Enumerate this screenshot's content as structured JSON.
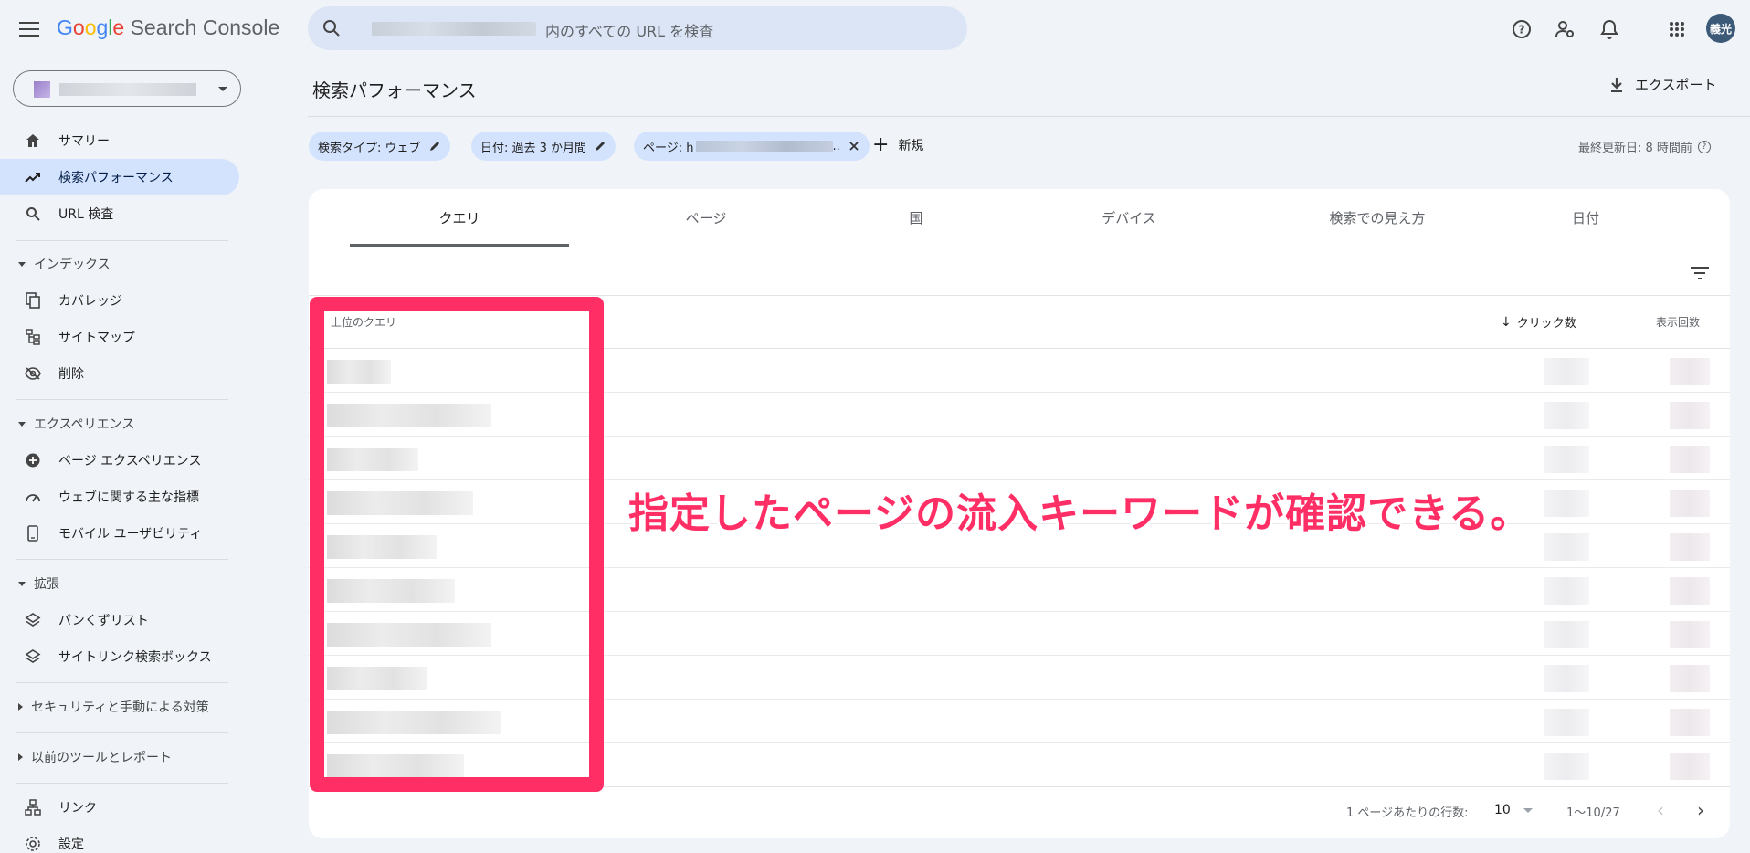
{
  "app": {
    "logo_google": "Google",
    "logo_rest": "Search Console"
  },
  "search": {
    "placeholder": "内のすべての URL を検査"
  },
  "avatar": {
    "text": "義光"
  },
  "sidebar": {
    "items": [
      {
        "label": "サマリー",
        "icon": "home-icon"
      },
      {
        "label": "検索パフォーマンス",
        "icon": "trending-up-icon"
      },
      {
        "label": "URL 検査",
        "icon": "search-icon"
      }
    ],
    "sections": [
      {
        "label": "インデックス",
        "items": [
          {
            "label": "カバレッジ",
            "icon": "file-copy-icon"
          },
          {
            "label": "サイトマップ",
            "icon": "sitemap-icon"
          },
          {
            "label": "削除",
            "icon": "visibility-off-icon"
          }
        ]
      },
      {
        "label": "エクスペリエンス",
        "items": [
          {
            "label": "ページ エクスペリエンス",
            "icon": "add-circle-icon"
          },
          {
            "label": "ウェブに関する主な指標",
            "icon": "speed-icon"
          },
          {
            "label": "モバイル ユーザビリティ",
            "icon": "smartphone-icon"
          }
        ]
      },
      {
        "label": "拡張",
        "items": [
          {
            "label": "パンくずリスト",
            "icon": "layers-icon"
          },
          {
            "label": "サイトリンク検索ボックス",
            "icon": "layers-icon"
          }
        ]
      }
    ],
    "collapsed": [
      "セキュリティと手動による対策",
      "以前のツールとレポート"
    ],
    "bottom": [
      {
        "label": "リンク",
        "icon": "links-icon"
      },
      {
        "label": "設定",
        "icon": "settings-icon"
      }
    ]
  },
  "main": {
    "title": "検索パフォーマンス",
    "export_label": "エクスポート",
    "chips": [
      {
        "label": "検索タイプ: ウェブ"
      },
      {
        "label": "日付: 過去 3 か月間"
      },
      {
        "label": "ページ: h",
        "suffix": ".."
      }
    ],
    "add_new": "新規",
    "last_updated": "最終更新日: 8 時間前",
    "tabs": [
      "クエリ",
      "ページ",
      "国",
      "デバイス",
      "検索での見え方",
      "日付"
    ],
    "table": {
      "col_query": "上位のクエリ",
      "col_clicks": "クリック数",
      "col_impressions": "表示回数",
      "row_count": 10
    },
    "pagination": {
      "rows_per_page_label": "1 ページあたりの行数:",
      "rows_per_page": "10",
      "range": "1〜10/27"
    }
  },
  "annotation": {
    "text": "指定したページの流入キーワードが確認できる。",
    "color": "#ff2f66"
  },
  "colors": {
    "active_nav": "#d3e3fd",
    "chip": "#d3e3fd",
    "background": "#f0f4f9",
    "accent": "#ff2f66"
  }
}
